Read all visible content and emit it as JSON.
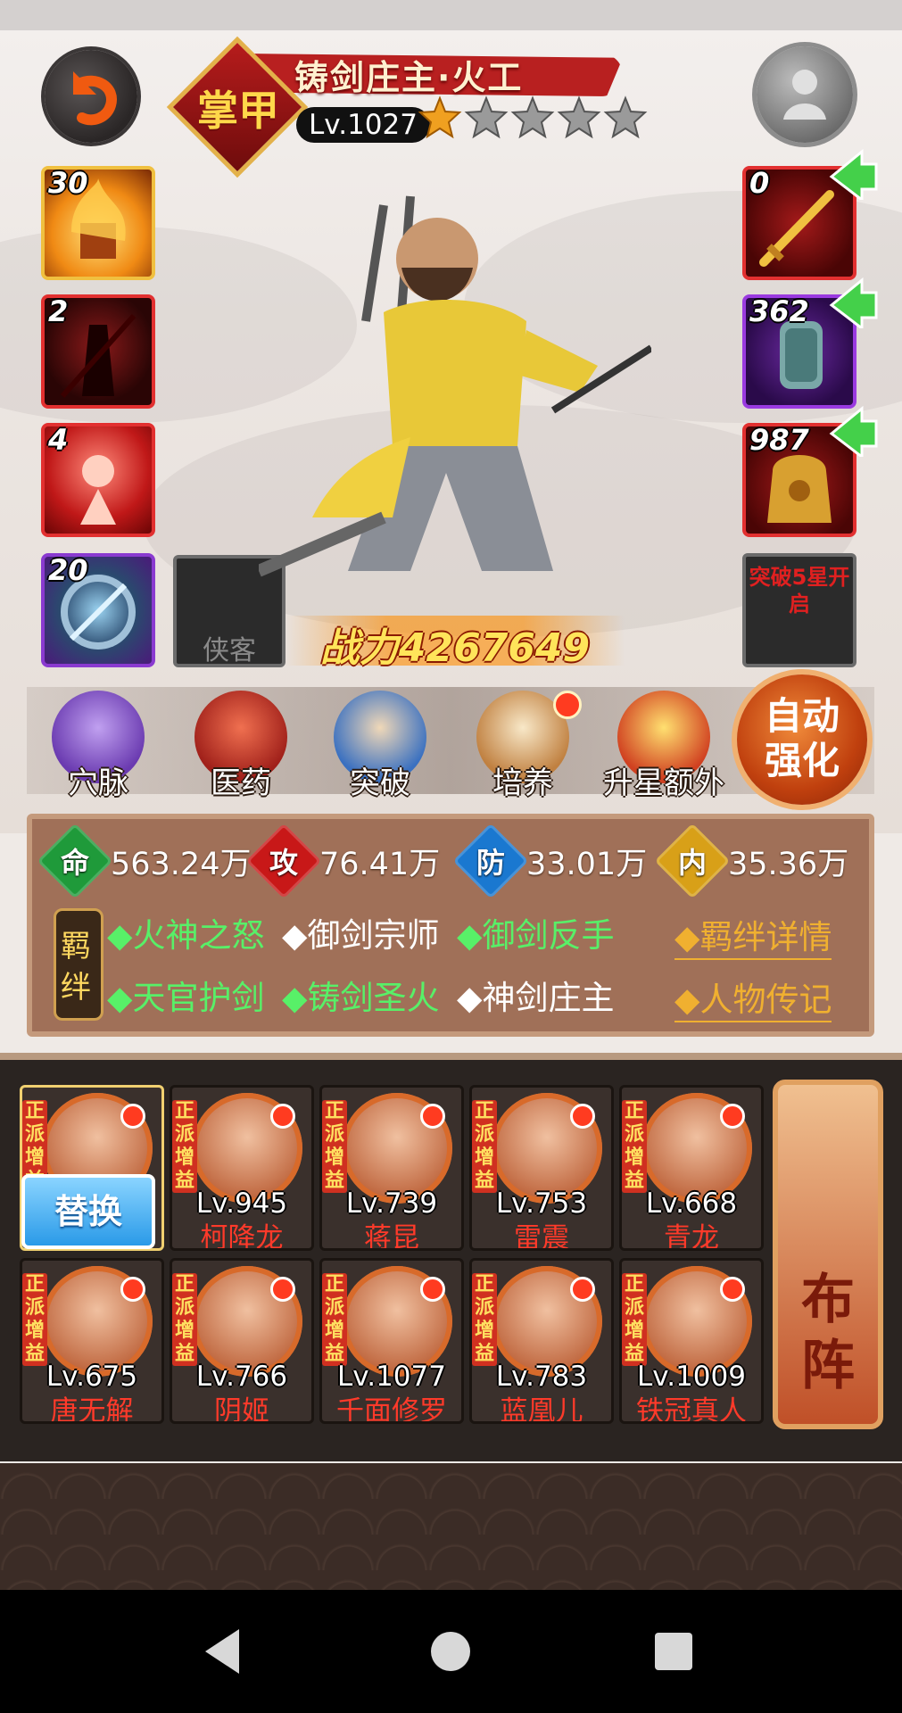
{
  "hero": {
    "name": "铸剑庄主·火工",
    "class_badge": "掌甲",
    "level": "Lv.1027",
    "stars_filled": 1,
    "stars_total": 5,
    "power": "战力4267649"
  },
  "skills": [
    {
      "count": "30",
      "icon": "fire-fist-skill-icon"
    },
    {
      "count": "2",
      "icon": "shadow-blade-skill-icon"
    },
    {
      "count": "4",
      "icon": "red-rune-skill-icon"
    },
    {
      "count": "20",
      "icon": "sword-disc-skill-icon"
    }
  ],
  "xiake_slot": {
    "label": "侠客"
  },
  "equipment": [
    {
      "count": "0",
      "icon": "golden-sword-icon"
    },
    {
      "count": "362",
      "icon": "jade-armguard-icon"
    },
    {
      "count": "987",
      "icon": "gold-armor-icon"
    }
  ],
  "breakthrough_slot": {
    "label": "突破5星开启"
  },
  "actions": [
    {
      "label": "穴脉",
      "icon": "meridian-icon",
      "dot": false
    },
    {
      "label": "医药",
      "icon": "medicine-icon",
      "dot": false
    },
    {
      "label": "突破",
      "icon": "breakthrough-icon",
      "dot": false
    },
    {
      "label": "培养",
      "icon": "scroll-icon",
      "dot": true
    },
    {
      "label": "升星额外",
      "icon": "star-up-icon",
      "dot": false
    }
  ],
  "auto_strengthen": {
    "label": "自动强化"
  },
  "stats": [
    {
      "badge": "命",
      "value": "563.24万",
      "color": "#1f9a3a"
    },
    {
      "badge": "攻",
      "value": "76.41万",
      "color": "#c81818"
    },
    {
      "badge": "防",
      "value": "33.01万",
      "color": "#1a78d0"
    },
    {
      "badge": "内",
      "value": "35.36万",
      "color": "#d8a018"
    }
  ],
  "bond_tag": "羁绊",
  "bonds": [
    {
      "text": "◆火神之怒",
      "active": true
    },
    {
      "text": "◆御剑宗师",
      "active": false
    },
    {
      "text": "◆御剑反手",
      "active": true
    },
    {
      "text": "◆天官护剑",
      "active": true
    },
    {
      "text": "◆铸剑圣火",
      "active": true
    },
    {
      "text": "◆神剑庄主",
      "active": false
    }
  ],
  "links": {
    "bond_detail": "◆羁绊详情",
    "biography": "◆人物传记"
  },
  "roster": {
    "faction_tag": "正派增益",
    "replace_label": "替换",
    "lineup_label": "布阵",
    "heroes": [
      {
        "level": "",
        "name": ""
      },
      {
        "level": "Lv.945",
        "name": "柯降龙"
      },
      {
        "level": "Lv.739",
        "name": "蒋昆"
      },
      {
        "level": "Lv.753",
        "name": "雷震"
      },
      {
        "level": "Lv.668",
        "name": "青龙"
      },
      {
        "level": "Lv.675",
        "name": "唐无解"
      },
      {
        "level": "Lv.766",
        "name": "阴姬"
      },
      {
        "level": "Lv.1077",
        "name": "千面修罗"
      },
      {
        "level": "Lv.783",
        "name": "蓝凰儿"
      },
      {
        "level": "Lv.1009",
        "name": "铁冠真人"
      }
    ]
  }
}
